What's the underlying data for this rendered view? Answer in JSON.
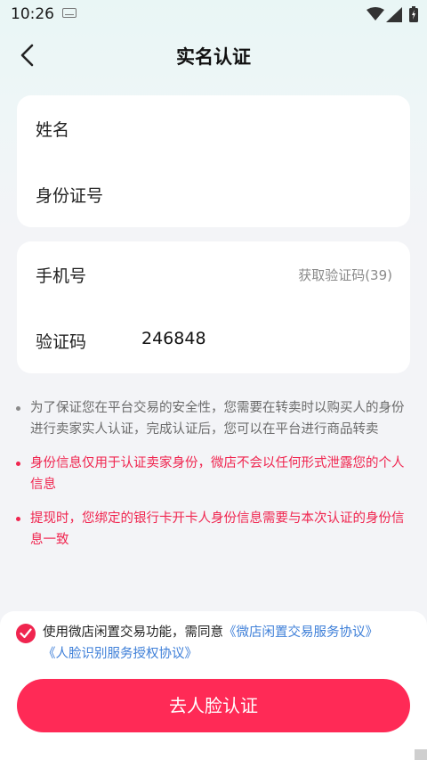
{
  "status_bar": {
    "time": "10:26"
  },
  "header": {
    "title": "实名认证"
  },
  "identity_card": {
    "name_label": "姓名",
    "id_label": "身份证号"
  },
  "phone_card": {
    "phone_label": "手机号",
    "get_code_label": "获取验证码(39)",
    "code_label": "验证码",
    "code_value": "246848"
  },
  "notes": [
    {
      "text": "为了保证您在平台交易的安全性，您需要在转卖时以购买人的身份进行卖家实人认证，完成认证后，您可以在平台进行商品转卖",
      "style": "gray"
    },
    {
      "text": "身份信息仅用于认证卖家身份，微店不会以任何形式泄露您的个人信息",
      "style": "red"
    },
    {
      "text": "提现时，您绑定的银行卡开卡人身份信息需要与本次认证的身份信息一致",
      "style": "red"
    }
  ],
  "agreement": {
    "prefix": "使用微店闲置交易功能，需同意",
    "link1": "《微店闲置交易服务协议》",
    "link2": "《人脸识别服务授权协议》",
    "checked": true
  },
  "primary_button": {
    "label": "去人脸认证"
  },
  "colors": {
    "accent": "#ff2a56",
    "note_red": "#f0254f",
    "link_blue": "#3e7fd8"
  }
}
